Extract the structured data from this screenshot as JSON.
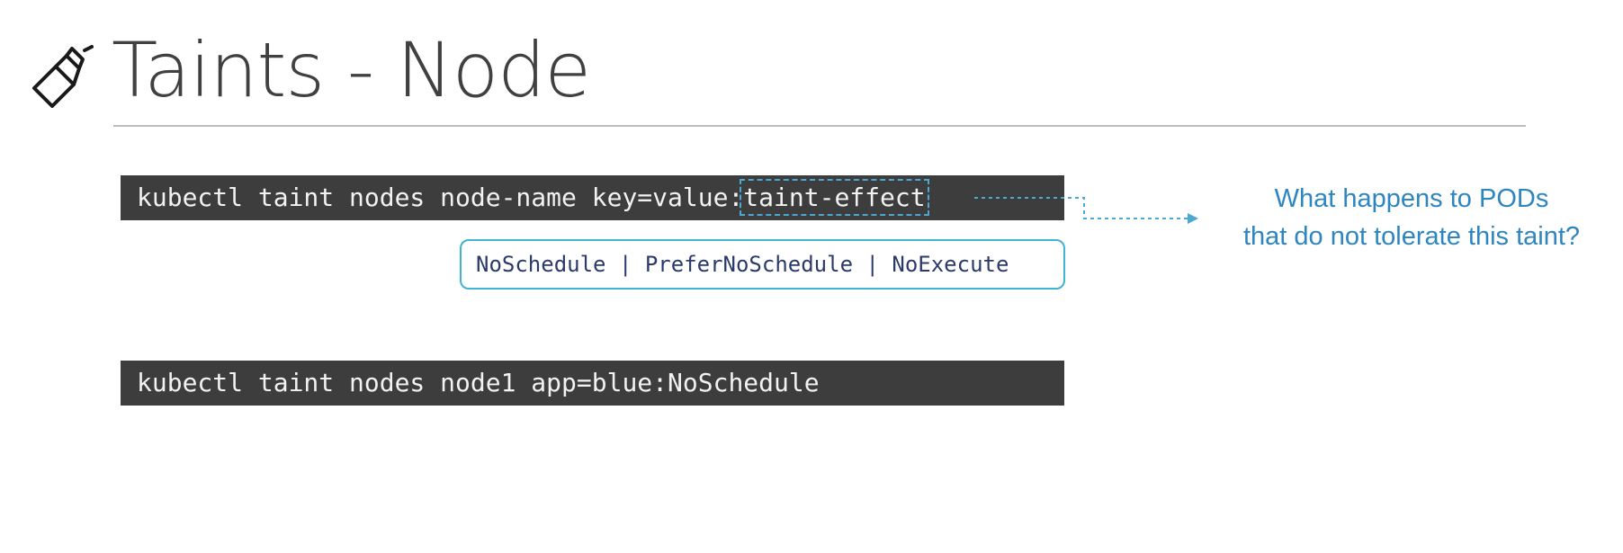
{
  "slide": {
    "title": "Taints - Node",
    "title_icon": "spray-bottle-icon",
    "command_generic": {
      "prefix": "kubectl taint nodes node-name key=value:",
      "highlighted": "taint-effect"
    },
    "effects": {
      "text": "NoSchedule | PreferNoSchedule | NoExecute"
    },
    "question": {
      "line1": "What happens to PODs",
      "line2": "that do not tolerate this taint?"
    },
    "command_example": "kubectl taint nodes node1 app=blue:NoSchedule"
  },
  "colors": {
    "title": "#404040",
    "code_background": "#3d3d3d",
    "code_text": "#f2f2f2",
    "accent_blue": "#2e86c1",
    "options_border": "#41b3d3",
    "options_text": "#2b3a6b"
  }
}
